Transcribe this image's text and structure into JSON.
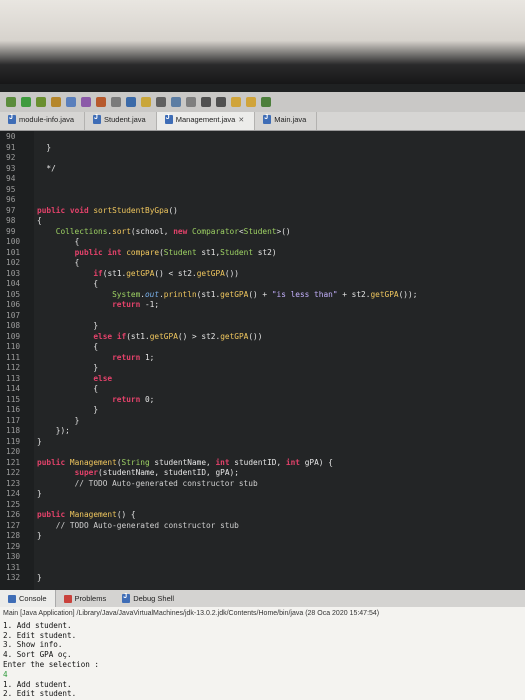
{
  "tabs": [
    {
      "label": "module-info.java"
    },
    {
      "label": "Student.java"
    },
    {
      "label": "Management.java",
      "active": true
    },
    {
      "label": "Main.java"
    }
  ],
  "editor": {
    "lines": [
      {
        "n": "90",
        "code": ""
      },
      {
        "n": "91",
        "code": "  }"
      },
      {
        "n": "92",
        "code": ""
      },
      {
        "n": "93",
        "code": "  */"
      },
      {
        "n": "94",
        "code": ""
      },
      {
        "n": "95",
        "code": ""
      },
      {
        "n": "96",
        "code": ""
      },
      {
        "n": "97",
        "code": "public void sortStudentByGpa()"
      },
      {
        "n": "98",
        "code": "{"
      },
      {
        "n": "99",
        "code": "    Collections.sort(school, new Comparator<Student>()"
      },
      {
        "n": "100",
        "code": "        {"
      },
      {
        "n": "101",
        "code": "        public int compare(Student st1,Student st2)"
      },
      {
        "n": "102",
        "code": "        {"
      },
      {
        "n": "103",
        "code": "            if(st1.getGPA() < st2.getGPA())"
      },
      {
        "n": "104",
        "code": "            {"
      },
      {
        "n": "105",
        "code": "                System.out.println(st1.getGPA() + \"is less than\" + st2.getGPA());"
      },
      {
        "n": "106",
        "code": "                return -1;"
      },
      {
        "n": "107",
        "code": ""
      },
      {
        "n": "108",
        "code": "            }"
      },
      {
        "n": "109",
        "code": "            else if(st1.getGPA() > st2.getGPA())"
      },
      {
        "n": "110",
        "code": "            {"
      },
      {
        "n": "111",
        "code": "                return 1;"
      },
      {
        "n": "112",
        "code": "            }"
      },
      {
        "n": "113",
        "code": "            else"
      },
      {
        "n": "114",
        "code": "            {"
      },
      {
        "n": "115",
        "code": "                return 0;"
      },
      {
        "n": "116",
        "code": "            }"
      },
      {
        "n": "117",
        "code": "        }"
      },
      {
        "n": "118",
        "code": "    });"
      },
      {
        "n": "119",
        "code": "}"
      },
      {
        "n": "120",
        "code": ""
      },
      {
        "n": "121",
        "code": "public Management(String studentName, int studentID, int gPA) {"
      },
      {
        "n": "122",
        "code": "        super(studentName, studentID, gPA);"
      },
      {
        "n": "123",
        "code": "        // TODO Auto-generated constructor stub"
      },
      {
        "n": "124",
        "code": "}"
      },
      {
        "n": "125",
        "code": ""
      },
      {
        "n": "126",
        "code": "public Management() {"
      },
      {
        "n": "127",
        "code": "    // TODO Auto-generated constructor stub"
      },
      {
        "n": "128",
        "code": "}"
      },
      {
        "n": "129",
        "code": ""
      },
      {
        "n": "130",
        "code": ""
      },
      {
        "n": "131",
        "code": ""
      },
      {
        "n": "132",
        "code": "}"
      }
    ]
  },
  "console": {
    "tabs": [
      {
        "label": "Console",
        "active": true
      },
      {
        "label": "Problems"
      },
      {
        "label": "Debug Shell"
      }
    ],
    "title": "Main [Java Application] /Library/Java/JavaVirtualMachines/jdk-13.0.2.jdk/Contents/Home/bin/java (28 Oca 2020 15:47:54)",
    "output": [
      {
        "text": "1. Add student."
      },
      {
        "text": "2. Edit student."
      },
      {
        "text": "3. Show info."
      },
      {
        "text": "4. Sort GPA oç."
      },
      {
        "text": "Enter the selection :"
      },
      {
        "text": "4",
        "input": true
      },
      {
        "text": "1. Add student."
      },
      {
        "text": "2. Edit student."
      }
    ]
  },
  "colors": {
    "keyword": "#e2426a",
    "type": "#9ed264",
    "method": "#f0c75e",
    "string": "#c5b2ff",
    "editor_bg": "#232526",
    "console_bg": "#f4f3f0"
  }
}
